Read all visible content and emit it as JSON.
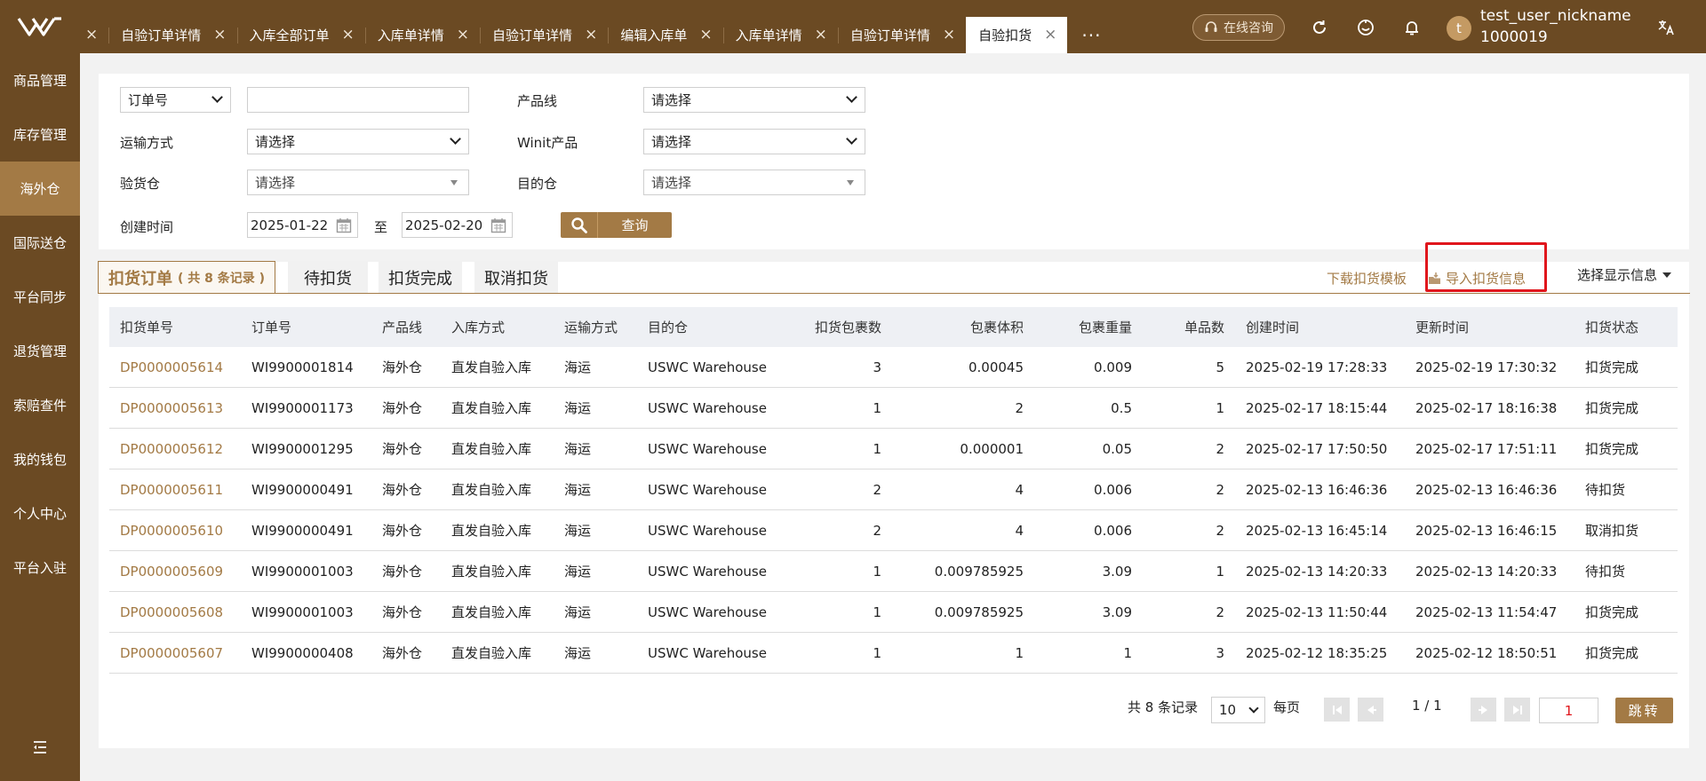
{
  "header": {
    "tabs": [
      {
        "label": "",
        "active": false
      },
      {
        "label": "自验订单详情",
        "active": false
      },
      {
        "label": "入库全部订单",
        "active": false
      },
      {
        "label": "入库单详情",
        "active": false
      },
      {
        "label": "自验订单详情",
        "active": false
      },
      {
        "label": "编辑入库单",
        "active": false
      },
      {
        "label": "入库单详情",
        "active": false
      },
      {
        "label": "自验订单详情",
        "active": false
      },
      {
        "label": "自验扣货",
        "active": true
      }
    ],
    "close_glyph": "×",
    "more_label": "···",
    "consult_label": "在线咨询",
    "icons": [
      "refresh-icon",
      "face-icon",
      "bell-icon",
      "translate-icon"
    ],
    "user": {
      "avatar_letter": "t",
      "nickname": "test_user_nickname",
      "id": "1000019"
    },
    "brand_color": "#6b4a23"
  },
  "sidebar": {
    "items": [
      {
        "label": "商品管理",
        "active": false
      },
      {
        "label": "库存管理",
        "active": false
      },
      {
        "label": "海外仓",
        "active": true
      },
      {
        "label": "国际送仓",
        "active": false
      },
      {
        "label": "平台同步",
        "active": false
      },
      {
        "label": "退货管理",
        "active": false
      },
      {
        "label": "索赔查件",
        "active": false
      },
      {
        "label": "我的钱包",
        "active": false
      },
      {
        "label": "个人中心",
        "active": false
      },
      {
        "label": "平台入驻",
        "active": false
      }
    ],
    "active_color": "#a37a45"
  },
  "filter": {
    "order_type_select": "订单号",
    "order_input_value": "",
    "product_line_label": "产品线",
    "product_line_value": "请选择",
    "transport_label": "运输方式",
    "transport_value": "请选择",
    "winit_label": "Winit产品",
    "winit_value": "请选择",
    "inspect_wh_label": "验货仓",
    "inspect_wh_value": "请选择",
    "dest_wh_label": "目的仓",
    "dest_wh_value": "请选择",
    "created_label": "创建时间",
    "date_from": "2025-01-22",
    "date_sep": "至",
    "date_to": "2025-02-20",
    "query_label": "查询"
  },
  "subtabs": {
    "tabs": [
      {
        "label": "扣货订单",
        "count": "( 共 8 条记录 )",
        "active": true
      },
      {
        "label": "待扣货",
        "active": false
      },
      {
        "label": "扣货完成",
        "active": false
      },
      {
        "label": "取消扣货",
        "active": false
      }
    ],
    "download_template": "下载扣货模板",
    "import_info": "导入扣货信息",
    "column_select": "选择显示信息",
    "accent": "#a37a45",
    "highlight": "#e0161c"
  },
  "table": {
    "headers": [
      "扣货单号",
      "订单号",
      "产品线",
      "入库方式",
      "运输方式",
      "目的仓",
      "扣货包裹数",
      "包裹体积",
      "包裹重量",
      "单品数",
      "创建时间",
      "更新时间",
      "扣货状态"
    ],
    "rows": [
      [
        "DP0000005614",
        "WI9900001814",
        "海外仓",
        "直发自验入库",
        "海运",
        "USWC Warehouse",
        "3",
        "0.00045",
        "0.009",
        "5",
        "2025-02-19 17:28:33",
        "2025-02-19 17:30:32",
        "扣货完成"
      ],
      [
        "DP0000005613",
        "WI9900001173",
        "海外仓",
        "直发自验入库",
        "海运",
        "USWC Warehouse",
        "1",
        "2",
        "0.5",
        "1",
        "2025-02-17 18:15:44",
        "2025-02-17 18:16:38",
        "扣货完成"
      ],
      [
        "DP0000005612",
        "WI9900001295",
        "海外仓",
        "直发自验入库",
        "海运",
        "USWC Warehouse",
        "1",
        "0.000001",
        "0.05",
        "2",
        "2025-02-17 17:50:50",
        "2025-02-17 17:51:11",
        "扣货完成"
      ],
      [
        "DP0000005611",
        "WI9900000491",
        "海外仓",
        "直发自验入库",
        "海运",
        "USWC Warehouse",
        "2",
        "4",
        "0.006",
        "2",
        "2025-02-13 16:46:36",
        "2025-02-13 16:46:36",
        "待扣货"
      ],
      [
        "DP0000005610",
        "WI9900000491",
        "海外仓",
        "直发自验入库",
        "海运",
        "USWC Warehouse",
        "2",
        "4",
        "0.006",
        "2",
        "2025-02-13 16:45:14",
        "2025-02-13 16:46:15",
        "取消扣货"
      ],
      [
        "DP0000005609",
        "WI9900001003",
        "海外仓",
        "直发自验入库",
        "海运",
        "USWC Warehouse",
        "1",
        "0.009785925",
        "3.09",
        "1",
        "2025-02-13 14:20:33",
        "2025-02-13 14:20:33",
        "待扣货"
      ],
      [
        "DP0000005608",
        "WI9900001003",
        "海外仓",
        "直发自验入库",
        "海运",
        "USWC Warehouse",
        "1",
        "0.009785925",
        "3.09",
        "2",
        "2025-02-13 11:50:44",
        "2025-02-13 11:54:47",
        "扣货完成"
      ],
      [
        "DP0000005607",
        "WI9900000408",
        "海外仓",
        "直发自验入库",
        "海运",
        "USWC Warehouse",
        "1",
        "1",
        "1",
        "3",
        "2025-02-12 18:35:25",
        "2025-02-12 18:50:51",
        "扣货完成"
      ]
    ]
  },
  "pagination": {
    "total_label": "共 8 条记录",
    "page_size": "10",
    "per_page_label": "每页",
    "page_info": "1 / 1",
    "page_input": "1",
    "jump_label": "跳转"
  }
}
